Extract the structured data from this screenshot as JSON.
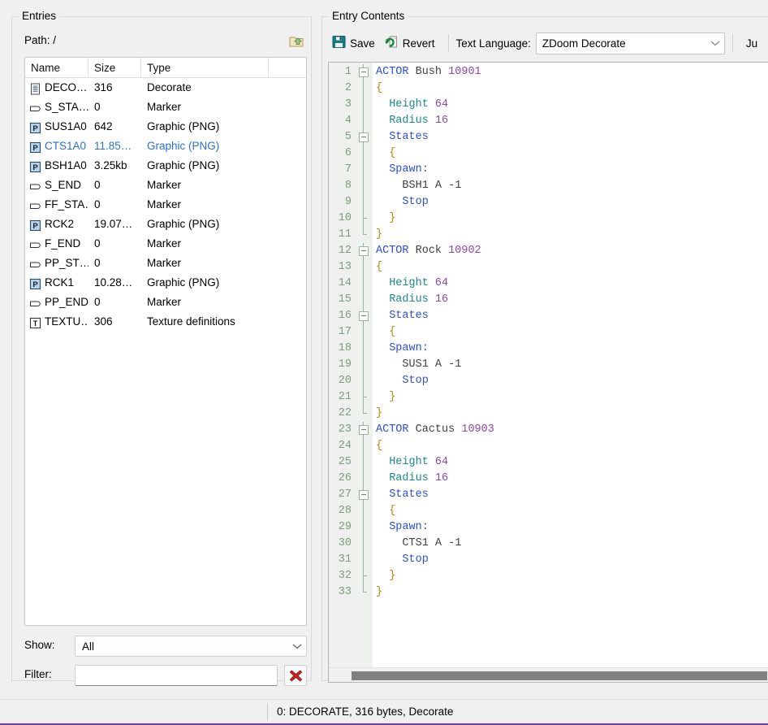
{
  "entries_panel": {
    "title": "Entries",
    "path_label": "Path: /",
    "up_folder_icon": "up-folder-icon",
    "columns": [
      "Name",
      "Size",
      "Type",
      ""
    ],
    "rows": [
      {
        "icon": "text-document-icon",
        "name": "DECO…",
        "size": "316",
        "type": "Decorate",
        "modified": false
      },
      {
        "icon": "marker-icon",
        "name": "S_STA…",
        "size": "0",
        "type": "Marker",
        "modified": false
      },
      {
        "icon": "png-graphic-icon",
        "name": "SUS1A0",
        "size": "642",
        "type": "Graphic (PNG)",
        "modified": false
      },
      {
        "icon": "png-graphic-icon",
        "name": "CTS1A0",
        "size": "11.85…",
        "type": "Graphic (PNG)",
        "modified": true
      },
      {
        "icon": "png-graphic-icon",
        "name": "BSH1A0",
        "size": "3.25kb",
        "type": "Graphic (PNG)",
        "modified": false
      },
      {
        "icon": "marker-icon",
        "name": "S_END",
        "size": "0",
        "type": "Marker",
        "modified": false
      },
      {
        "icon": "marker-icon",
        "name": "FF_STA…",
        "size": "0",
        "type": "Marker",
        "modified": false
      },
      {
        "icon": "png-graphic-icon",
        "name": "RCK2",
        "size": "19.07…",
        "type": "Graphic (PNG)",
        "modified": false
      },
      {
        "icon": "marker-icon",
        "name": "F_END",
        "size": "0",
        "type": "Marker",
        "modified": false
      },
      {
        "icon": "marker-icon",
        "name": "PP_ST…",
        "size": "0",
        "type": "Marker",
        "modified": false
      },
      {
        "icon": "png-graphic-icon",
        "name": "RCK1",
        "size": "10.28…",
        "type": "Graphic (PNG)",
        "modified": false
      },
      {
        "icon": "marker-icon",
        "name": "PP_END",
        "size": "0",
        "type": "Marker",
        "modified": false
      },
      {
        "icon": "texture-definitions-icon",
        "name": "TEXTU…",
        "size": "306",
        "type": "Texture definitions",
        "modified": false
      }
    ],
    "show_label": "Show:",
    "show_value": "All",
    "filter_label": "Filter:",
    "filter_value": "",
    "filter_placeholder": "",
    "filter_clear_icon": "red-x-clear-icon"
  },
  "contents_panel": {
    "title": "Entry Contents",
    "save_label": "Save",
    "save_icon": "floppy-disk-save-icon",
    "revert_label": "Revert",
    "revert_icon": "revert-refresh-icon",
    "language_label": "Text Language:",
    "language_value": "ZDoom Decorate",
    "jump_label": "Ju"
  },
  "editor": {
    "lines": [
      {
        "n": "1",
        "fold": "open",
        "tokens": [
          {
            "t": "ACTOR",
            "c": "k-actor"
          },
          {
            "t": " ",
            "c": "k-plain"
          },
          {
            "t": "Bush",
            "c": "k-name"
          },
          {
            "t": " ",
            "c": "k-plain"
          },
          {
            "t": "10901",
            "c": "k-num"
          }
        ]
      },
      {
        "n": "2",
        "fold": "line",
        "tokens": [
          {
            "t": "{",
            "c": "k-brace"
          }
        ]
      },
      {
        "n": "3",
        "fold": "line",
        "tokens": [
          {
            "t": "  ",
            "c": "k-plain"
          },
          {
            "t": "Height",
            "c": "k-prop"
          },
          {
            "t": " ",
            "c": "k-plain"
          },
          {
            "t": "64",
            "c": "k-num"
          }
        ]
      },
      {
        "n": "4",
        "fold": "line",
        "tokens": [
          {
            "t": "  ",
            "c": "k-plain"
          },
          {
            "t": "Radius",
            "c": "k-prop"
          },
          {
            "t": " ",
            "c": "k-plain"
          },
          {
            "t": "16",
            "c": "k-num"
          }
        ]
      },
      {
        "n": "5",
        "fold": "open",
        "tokens": [
          {
            "t": "  ",
            "c": "k-plain"
          },
          {
            "t": "States",
            "c": "k-state"
          }
        ]
      },
      {
        "n": "6",
        "fold": "line",
        "tokens": [
          {
            "t": "  ",
            "c": "k-plain"
          },
          {
            "t": "{",
            "c": "k-brace"
          }
        ]
      },
      {
        "n": "7",
        "fold": "line",
        "tokens": [
          {
            "t": "  ",
            "c": "k-plain"
          },
          {
            "t": "Spawn:",
            "c": "k-label"
          }
        ]
      },
      {
        "n": "8",
        "fold": "line",
        "tokens": [
          {
            "t": "    ",
            "c": "k-plain"
          },
          {
            "t": "BSH1 A -1",
            "c": "k-plain"
          }
        ]
      },
      {
        "n": "9",
        "fold": "line",
        "tokens": [
          {
            "t": "    ",
            "c": "k-plain"
          },
          {
            "t": "Stop",
            "c": "k-label"
          }
        ]
      },
      {
        "n": "10",
        "fold": "tick",
        "tokens": [
          {
            "t": "  ",
            "c": "k-plain"
          },
          {
            "t": "}",
            "c": "k-brace"
          }
        ]
      },
      {
        "n": "11",
        "fold": "end",
        "tokens": [
          {
            "t": "}",
            "c": "k-brace"
          }
        ]
      },
      {
        "n": "12",
        "fold": "open",
        "tokens": [
          {
            "t": "ACTOR",
            "c": "k-actor"
          },
          {
            "t": " ",
            "c": "k-plain"
          },
          {
            "t": "Rock",
            "c": "k-name"
          },
          {
            "t": " ",
            "c": "k-plain"
          },
          {
            "t": "10902",
            "c": "k-num"
          }
        ]
      },
      {
        "n": "13",
        "fold": "line",
        "tokens": [
          {
            "t": "{",
            "c": "k-brace"
          }
        ]
      },
      {
        "n": "14",
        "fold": "line",
        "tokens": [
          {
            "t": "  ",
            "c": "k-plain"
          },
          {
            "t": "Height",
            "c": "k-prop"
          },
          {
            "t": " ",
            "c": "k-plain"
          },
          {
            "t": "64",
            "c": "k-num"
          }
        ]
      },
      {
        "n": "15",
        "fold": "line",
        "tokens": [
          {
            "t": "  ",
            "c": "k-plain"
          },
          {
            "t": "Radius",
            "c": "k-prop"
          },
          {
            "t": " ",
            "c": "k-plain"
          },
          {
            "t": "16",
            "c": "k-num"
          }
        ]
      },
      {
        "n": "16",
        "fold": "open",
        "tokens": [
          {
            "t": "  ",
            "c": "k-plain"
          },
          {
            "t": "States",
            "c": "k-state"
          }
        ]
      },
      {
        "n": "17",
        "fold": "line",
        "tokens": [
          {
            "t": "  ",
            "c": "k-plain"
          },
          {
            "t": "{",
            "c": "k-brace"
          }
        ]
      },
      {
        "n": "18",
        "fold": "line",
        "tokens": [
          {
            "t": "  ",
            "c": "k-plain"
          },
          {
            "t": "Spawn:",
            "c": "k-label"
          }
        ]
      },
      {
        "n": "19",
        "fold": "line",
        "tokens": [
          {
            "t": "    ",
            "c": "k-plain"
          },
          {
            "t": "SUS1 A -1",
            "c": "k-plain"
          }
        ]
      },
      {
        "n": "20",
        "fold": "line",
        "tokens": [
          {
            "t": "    ",
            "c": "k-plain"
          },
          {
            "t": "Stop",
            "c": "k-label"
          }
        ]
      },
      {
        "n": "21",
        "fold": "tick",
        "tokens": [
          {
            "t": "  ",
            "c": "k-plain"
          },
          {
            "t": "}",
            "c": "k-brace"
          }
        ]
      },
      {
        "n": "22",
        "fold": "end",
        "tokens": [
          {
            "t": "}",
            "c": "k-brace"
          }
        ]
      },
      {
        "n": "23",
        "fold": "open",
        "tokens": [
          {
            "t": "ACTOR",
            "c": "k-actor"
          },
          {
            "t": " ",
            "c": "k-plain"
          },
          {
            "t": "Cactus",
            "c": "k-name"
          },
          {
            "t": " ",
            "c": "k-plain"
          },
          {
            "t": "10903",
            "c": "k-num"
          }
        ]
      },
      {
        "n": "24",
        "fold": "line",
        "tokens": [
          {
            "t": "{",
            "c": "k-brace"
          }
        ]
      },
      {
        "n": "25",
        "fold": "line",
        "tokens": [
          {
            "t": "  ",
            "c": "k-plain"
          },
          {
            "t": "Height",
            "c": "k-prop"
          },
          {
            "t": " ",
            "c": "k-plain"
          },
          {
            "t": "64",
            "c": "k-num"
          }
        ]
      },
      {
        "n": "26",
        "fold": "line",
        "tokens": [
          {
            "t": "  ",
            "c": "k-plain"
          },
          {
            "t": "Radius",
            "c": "k-prop"
          },
          {
            "t": " ",
            "c": "k-plain"
          },
          {
            "t": "16",
            "c": "k-num"
          }
        ]
      },
      {
        "n": "27",
        "fold": "open",
        "tokens": [
          {
            "t": "  ",
            "c": "k-plain"
          },
          {
            "t": "States",
            "c": "k-state"
          }
        ]
      },
      {
        "n": "28",
        "fold": "line",
        "tokens": [
          {
            "t": "  ",
            "c": "k-plain"
          },
          {
            "t": "{",
            "c": "k-brace"
          }
        ]
      },
      {
        "n": "29",
        "fold": "line",
        "tokens": [
          {
            "t": "  ",
            "c": "k-plain"
          },
          {
            "t": "Spawn:",
            "c": "k-label"
          }
        ]
      },
      {
        "n": "30",
        "fold": "line",
        "tokens": [
          {
            "t": "    ",
            "c": "k-plain"
          },
          {
            "t": "CTS1 A -1",
            "c": "k-plain"
          }
        ]
      },
      {
        "n": "31",
        "fold": "line",
        "tokens": [
          {
            "t": "    ",
            "c": "k-plain"
          },
          {
            "t": "Stop",
            "c": "k-label"
          }
        ]
      },
      {
        "n": "32",
        "fold": "tick",
        "tokens": [
          {
            "t": "  ",
            "c": "k-plain"
          },
          {
            "t": "}",
            "c": "k-brace"
          }
        ]
      },
      {
        "n": "33",
        "fold": "end",
        "tokens": [
          {
            "t": "}",
            "c": "k-brace"
          }
        ]
      }
    ]
  },
  "statusbar": {
    "text": "0: DECORATE, 316 bytes, Decorate"
  },
  "colors": {
    "accent_purple": "#6b3fa0",
    "modified_blue": "#2a6fd6",
    "keyword_blue": "#2c4fd6",
    "property_teal": "#1a8a8a",
    "number_purple": "#8e44ad",
    "gutter_bg": "#eef1ee"
  }
}
